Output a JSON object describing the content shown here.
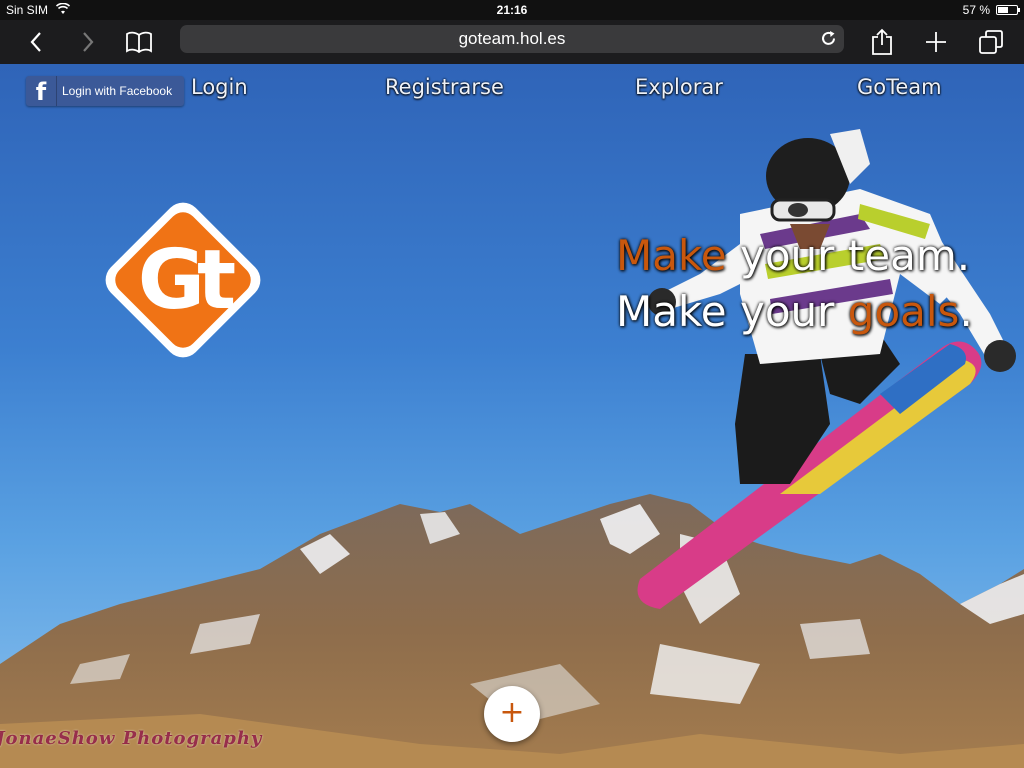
{
  "status_bar": {
    "carrier": "Sin SIM",
    "time": "21:16",
    "battery_text": "57 %",
    "battery_level": 0.57
  },
  "browser": {
    "url": "goteam.hol.es",
    "icons": [
      "back-icon",
      "forward-icon",
      "bookmarks-icon",
      "reload-icon",
      "share-icon",
      "new-tab-icon",
      "tabs-icon"
    ]
  },
  "page": {
    "facebook_login": {
      "icon": "f",
      "label": "Login with Facebook"
    },
    "nav": [
      {
        "label": "Login"
      },
      {
        "label": "Registrarse"
      },
      {
        "label": "Explorar"
      },
      {
        "label": "GoTeam"
      }
    ],
    "logo_text": "Gt",
    "tagline": {
      "line1_accent": "Make",
      "line1_rest": " your team.",
      "line2_start": "Make your ",
      "line2_accent": "goals",
      "line2_end": "."
    },
    "fab_label": "+",
    "watermark": "JonaeShow Photography",
    "colors": {
      "accent": "#c8570d",
      "logo_orange": "#f07315",
      "facebook_blue": "#3b5998",
      "sky": "#3c7fd0"
    }
  }
}
